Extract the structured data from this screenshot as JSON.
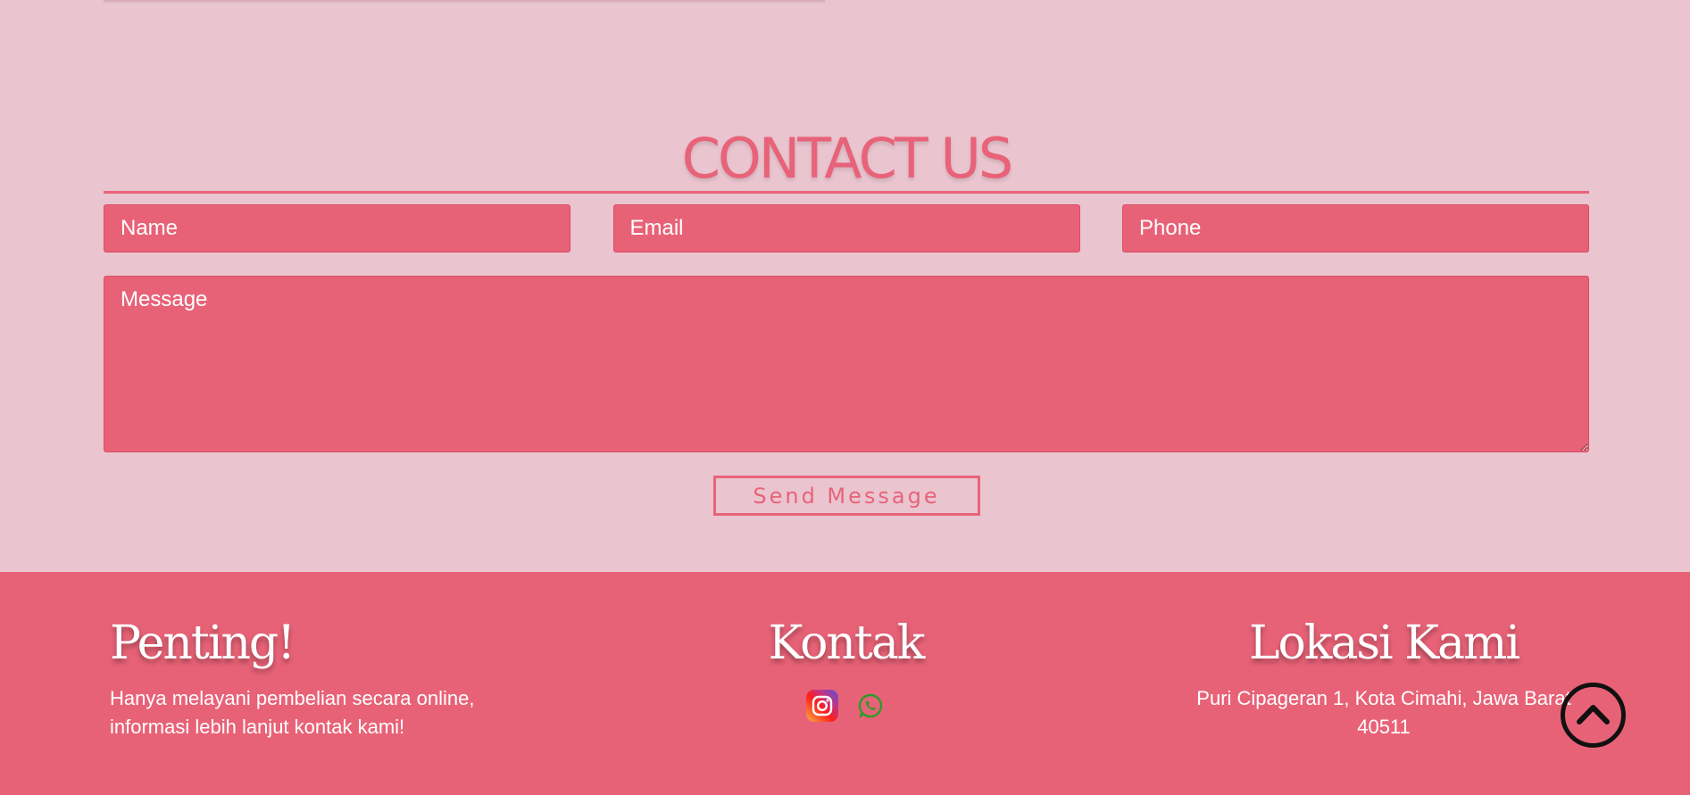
{
  "contact": {
    "title": "CONTACT US",
    "name_placeholder": "Name",
    "email_placeholder": "Email",
    "phone_placeholder": "Phone",
    "message_placeholder": "Message",
    "send_label": "Send Message"
  },
  "footer": {
    "penting": {
      "heading": "Penting!",
      "text": "Hanya melayani pembelian secara online, informasi lebih lanjut kontak kami!"
    },
    "kontak": {
      "heading": "Kontak",
      "icons": [
        "instagram-icon",
        "whatsapp-icon"
      ]
    },
    "lokasi": {
      "heading": "Lokasi Kami",
      "address": "Puri Cipageran 1, Kota Cimahi, Jawa Barat 40511"
    }
  },
  "colors": {
    "page_background": "#eac5cf",
    "accent": "#e8637a",
    "footer_background": "#e86277",
    "whatsapp_green": "#2a9d2a"
  },
  "scroll_top_icon": "chevron-up-circle-icon"
}
